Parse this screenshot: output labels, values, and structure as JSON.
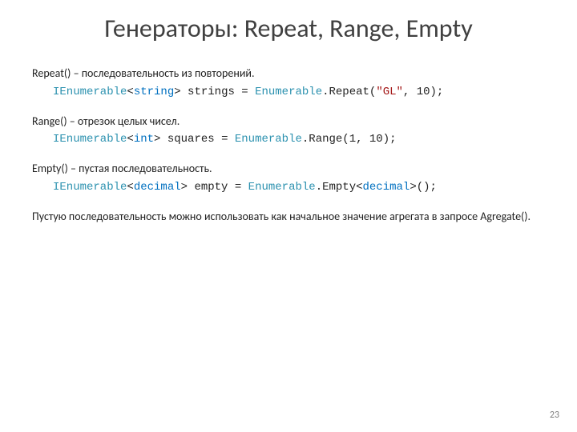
{
  "title": "Генераторы: Repeat, Range, Empty",
  "repeat": {
    "desc": "Repeat() – последовательность из повторений.",
    "t1": "IEnumerable",
    "t2": "<",
    "t3": "string",
    "t4": ">",
    "t5": " strings = ",
    "t6": "Enumerable",
    "t7": ".Repeat(",
    "t8": "\"GL\"",
    "t9": ", 10);"
  },
  "range": {
    "desc": "Range() – отрезок целых чисел.",
    "t1": "IEnumerable",
    "t2": "<",
    "t3": "int",
    "t4": ">",
    "t5": " squares = ",
    "t6": "Enumerable",
    "t7": ".Range(1, 10);"
  },
  "empty": {
    "desc": "Empty() – пустая последовательность.",
    "t1": "IEnumerable",
    "t2": "<",
    "t3": "decimal",
    "t4": ">",
    "t5": " empty = ",
    "t6": "Enumerable",
    "t7": ".Empty<",
    "t8": "decimal",
    "t9": ">();"
  },
  "footer_text": "Пустую последовательность можно использовать как начальное значение агрегата в запросе Agregate().",
  "page_number": "23"
}
